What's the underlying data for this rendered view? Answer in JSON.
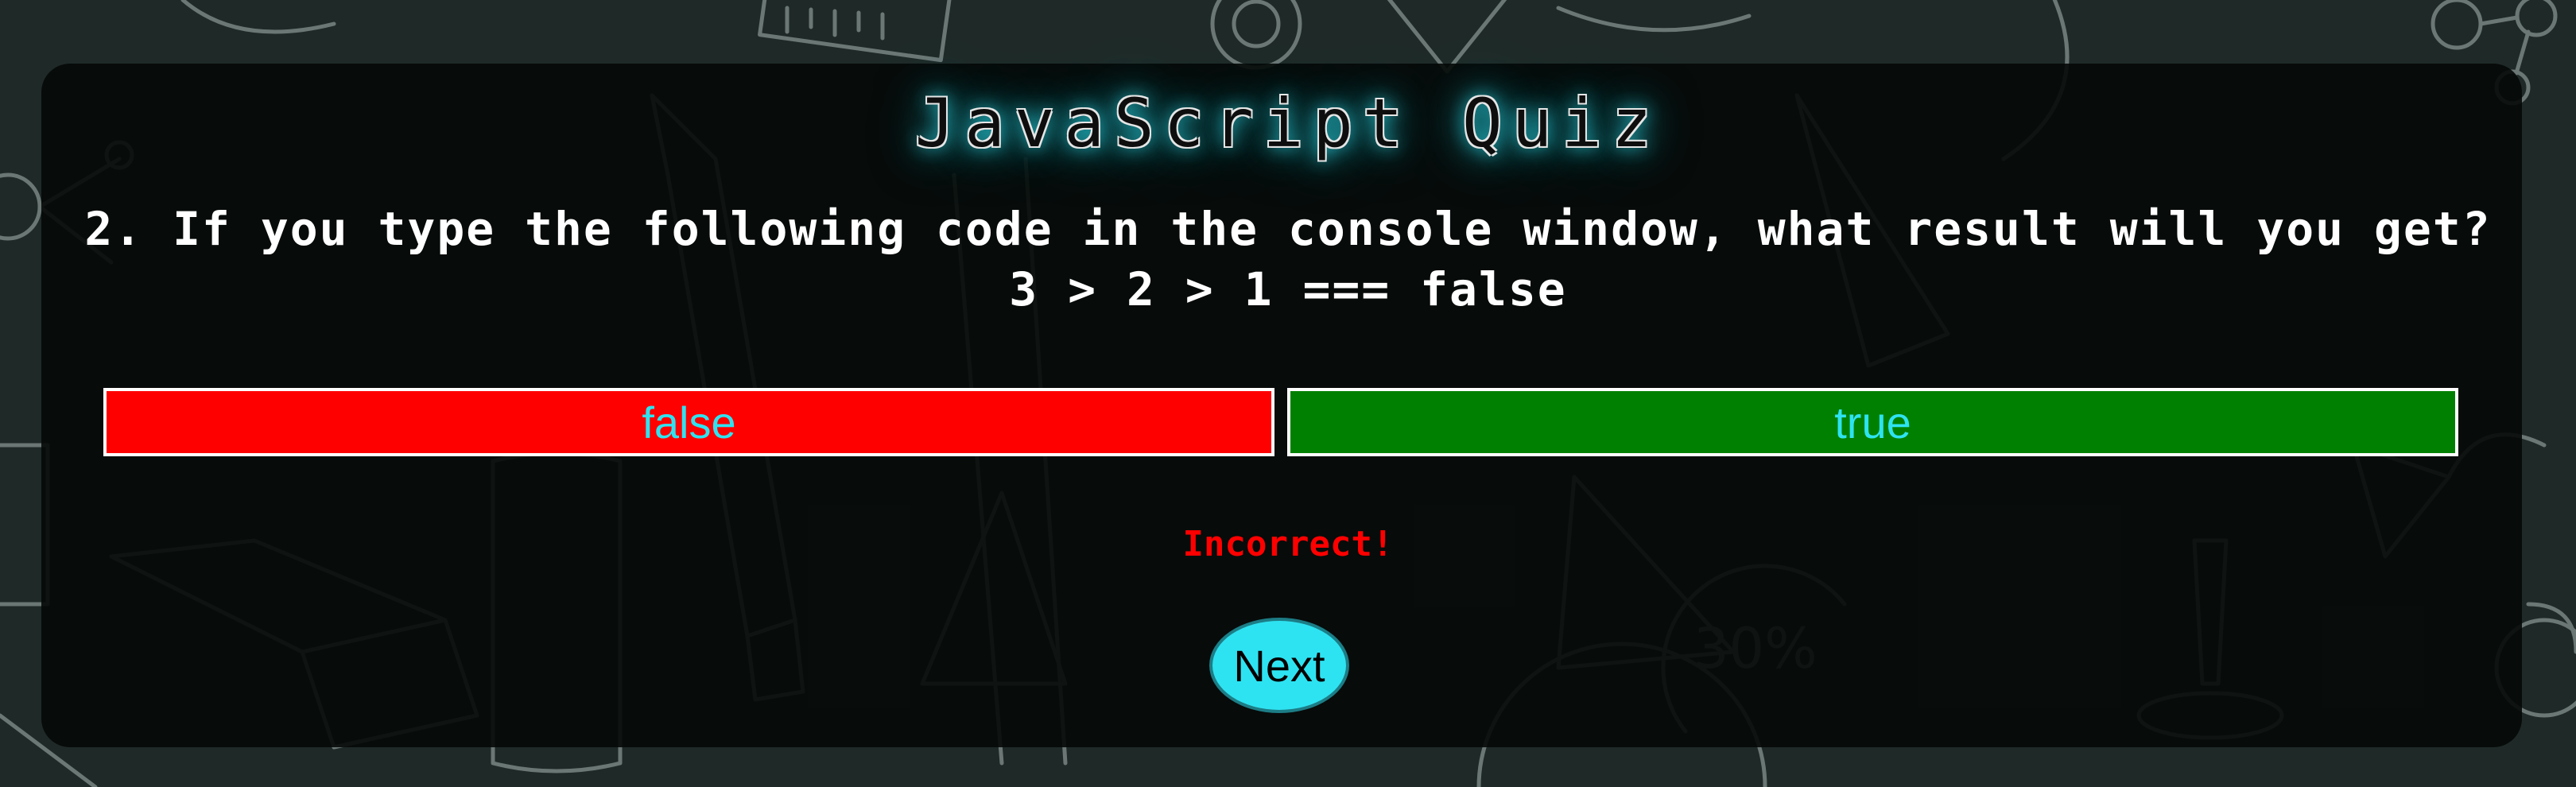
{
  "quiz": {
    "title": "JavaScript Quiz",
    "question": "2. If you type the following code in the console window, what result will you get? 3 > 2 > 1 === false",
    "answers": [
      {
        "label": "false",
        "state": "incorrect-selected",
        "color": "#ff0000"
      },
      {
        "label": "true",
        "state": "correct",
        "color": "#008000"
      }
    ],
    "feedback": "Incorrect!",
    "next_label": "Next"
  },
  "colors": {
    "accent": "#2ee3f1",
    "incorrect": "#ff0000",
    "correct": "#008000",
    "panel": "#060908"
  },
  "background": {
    "icon_names": [
      "chalkboard-doodle-icons"
    ]
  }
}
